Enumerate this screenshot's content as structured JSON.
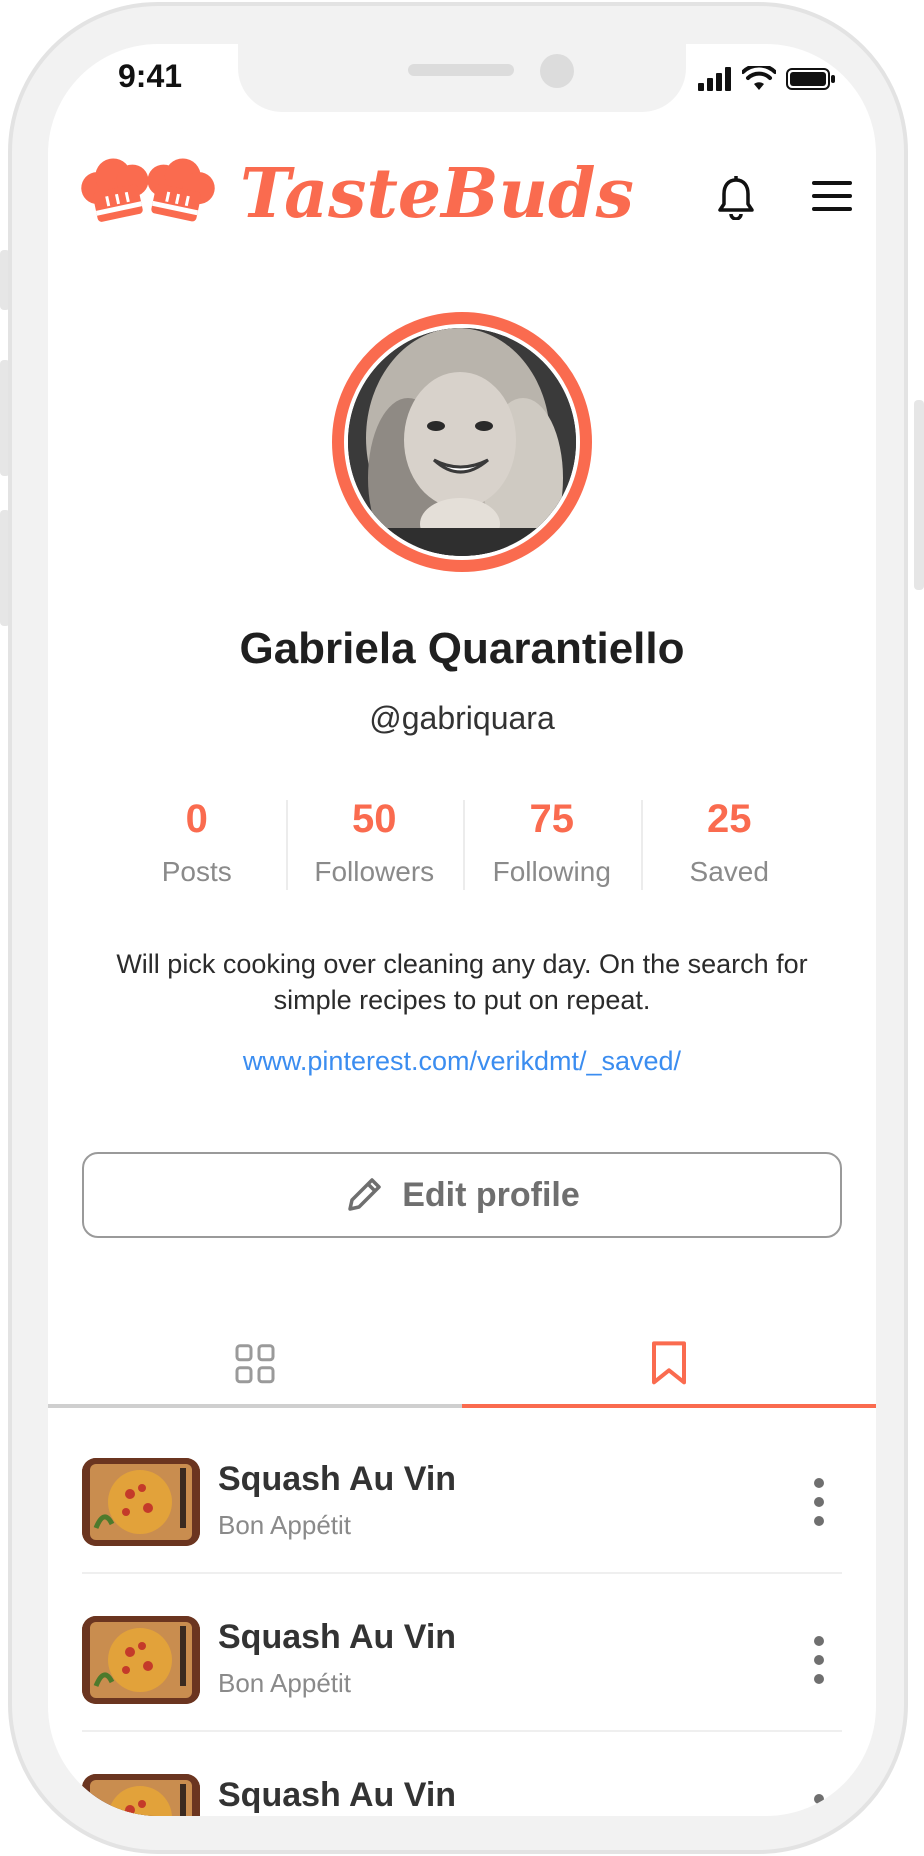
{
  "status_bar": {
    "time": "9:41"
  },
  "app": {
    "name": "TasteBuds",
    "brand_color": "#fa6b4f"
  },
  "profile": {
    "name": "Gabriela Quarantiello",
    "handle": "@gabriquara",
    "stats": [
      {
        "value": "0",
        "label": "Posts"
      },
      {
        "value": "50",
        "label": "Followers"
      },
      {
        "value": "75",
        "label": "Following"
      },
      {
        "value": "25",
        "label": "Saved"
      }
    ],
    "bio": "Will pick cooking over cleaning any day. On the search for simple recipes to put on repeat.",
    "link": "www.pinterest.com/verikdmt/_saved/",
    "edit_label": "Edit profile"
  },
  "tabs": [
    {
      "icon": "grid-icon",
      "active": false
    },
    {
      "icon": "bookmark-icon",
      "active": true
    }
  ],
  "saved_items": [
    {
      "title": "Squash Au Vin",
      "source": "Bon Appétit"
    },
    {
      "title": "Squash Au Vin",
      "source": "Bon Appétit"
    },
    {
      "title": "Squash Au Vin",
      "source": ""
    }
  ]
}
